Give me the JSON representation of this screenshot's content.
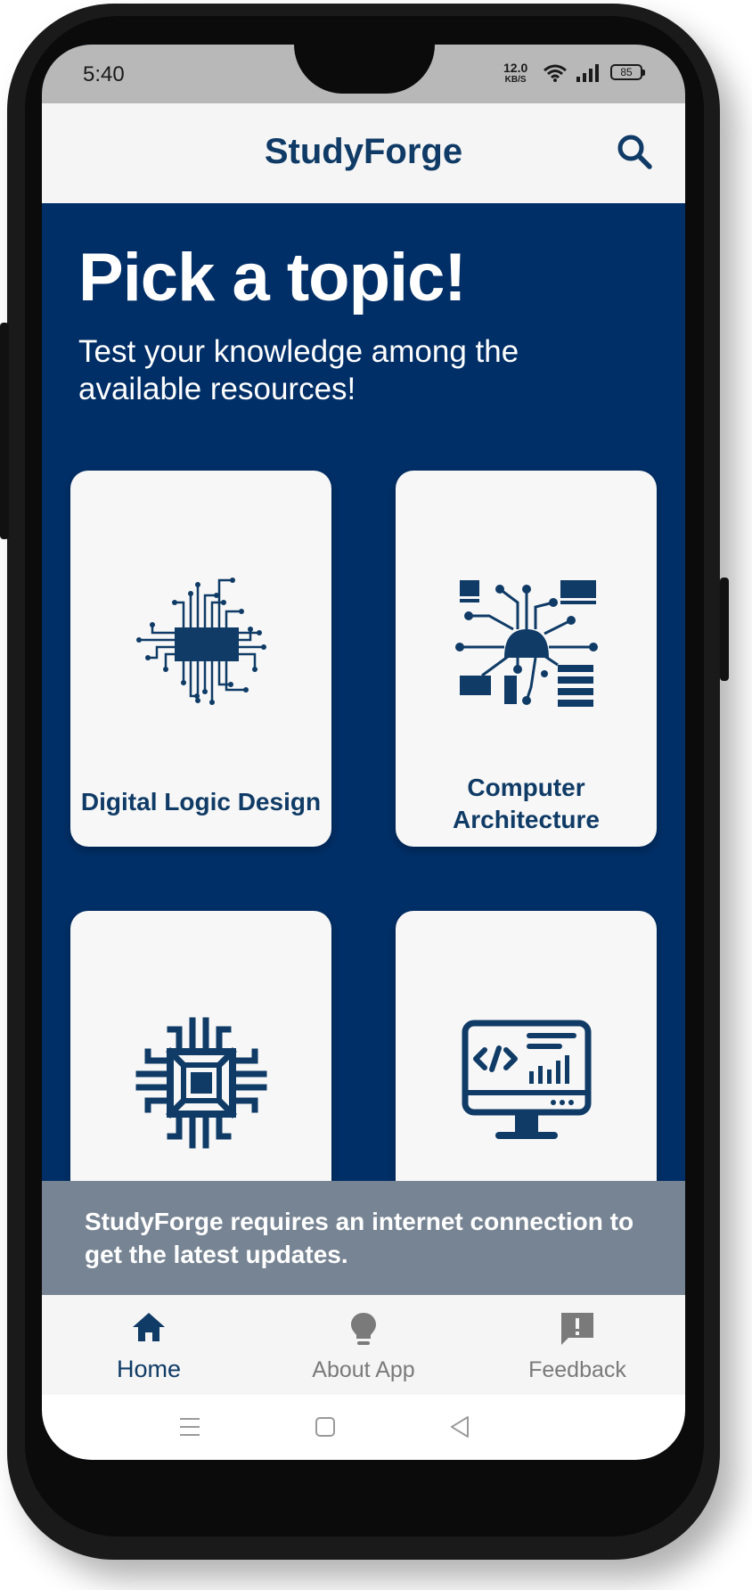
{
  "status_bar": {
    "time": "5:40",
    "net_speed_value": "12.0",
    "net_speed_unit": "KB/S",
    "battery": "85"
  },
  "app_bar": {
    "title": "StudyForge"
  },
  "hero": {
    "title": "Pick a topic!",
    "subtitle": "Test your knowledge among the available resources!"
  },
  "topics": [
    {
      "label": "Digital Logic Design",
      "icon": "microchip-circuit-icon"
    },
    {
      "label": "Computer Architecture",
      "icon": "cpu-network-icon"
    },
    {
      "label": "",
      "icon": "processor-chip-icon"
    },
    {
      "label": "",
      "icon": "monitor-code-icon"
    }
  ],
  "snackbar": {
    "message": "StudyForge requires an internet connection to get the latest updates."
  },
  "bottom_nav": {
    "items": [
      {
        "label": "Home",
        "icon": "home-icon",
        "active": true
      },
      {
        "label": "About App",
        "icon": "lightbulb-icon",
        "active": false
      },
      {
        "label": "Feedback",
        "icon": "feedback-icon",
        "active": false
      }
    ]
  },
  "colors": {
    "primary": "#002f67",
    "brand_text": "#0f3b66",
    "snackbar": "#778493",
    "inactive": "#7a7a7a"
  }
}
